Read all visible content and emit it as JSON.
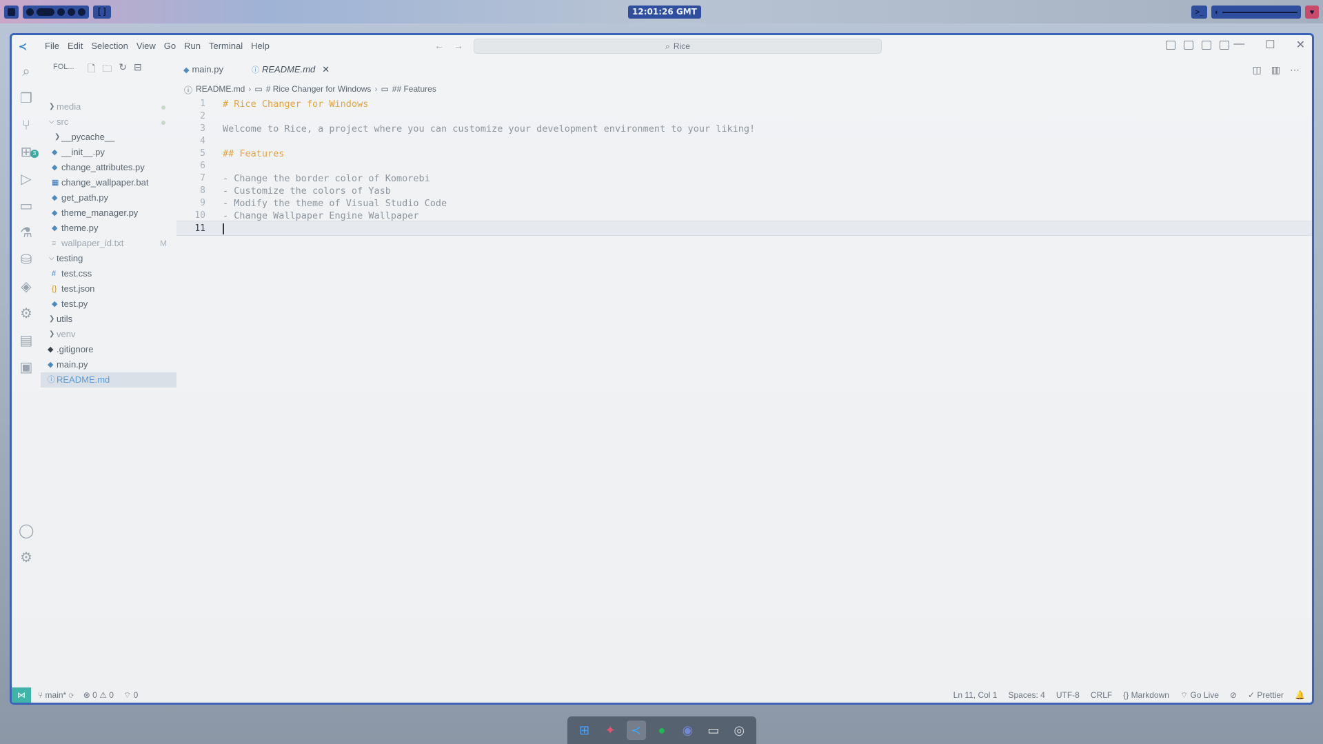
{
  "topbar": {
    "clock": "12:01:26 GMT",
    "terminal_icon": ">_"
  },
  "window": {
    "menu": [
      "File",
      "Edit",
      "Selection",
      "View",
      "Go",
      "Run",
      "Terminal",
      "Help"
    ],
    "search_label": "Rice"
  },
  "activity_bar": {
    "source_control_badge": "3"
  },
  "explorer": {
    "header": "FOL...",
    "items": [
      {
        "label": "media",
        "type": "folder",
        "collapsed": true,
        "dim": true
      },
      {
        "label": "src",
        "type": "folder",
        "collapsed": false,
        "dim": true
      },
      {
        "label": "__pycache__",
        "type": "folder",
        "collapsed": true
      },
      {
        "label": "__init__.py",
        "type": "py"
      },
      {
        "label": "change_attributes.py",
        "type": "py"
      },
      {
        "label": "change_wallpaper.bat",
        "type": "bat"
      },
      {
        "label": "get_path.py",
        "type": "py"
      },
      {
        "label": "theme_manager.py",
        "type": "py"
      },
      {
        "label": "theme.py",
        "type": "py"
      },
      {
        "label": "wallpaper_id.txt",
        "type": "txt",
        "dim": true,
        "badge": "M"
      },
      {
        "label": "testing",
        "type": "folder",
        "collapsed": false
      },
      {
        "label": "test.css",
        "type": "css"
      },
      {
        "label": "test.json",
        "type": "json"
      },
      {
        "label": "test.py",
        "type": "py"
      },
      {
        "label": "utils",
        "type": "folder",
        "collapsed": true
      },
      {
        "label": "venv",
        "type": "folder",
        "collapsed": true,
        "dim": true
      },
      {
        "label": ".gitignore",
        "type": "git"
      },
      {
        "label": "main.py",
        "type": "py"
      },
      {
        "label": "README.md",
        "type": "md",
        "selected": true
      }
    ]
  },
  "tabs": [
    {
      "label": "main.py",
      "active": false
    },
    {
      "label": "README.md",
      "active": true
    }
  ],
  "breadcrumb": [
    "README.md",
    "# Rice Changer for Windows",
    "## Features"
  ],
  "editor": {
    "lines": [
      {
        "n": "1",
        "text": "# Rice Changer for Windows",
        "heading": true
      },
      {
        "n": "2",
        "text": ""
      },
      {
        "n": "3",
        "text": "Welcome to Rice, a project where you can customize your development environment to your liking!"
      },
      {
        "n": "4",
        "text": ""
      },
      {
        "n": "5",
        "text": "## Features",
        "heading": true
      },
      {
        "n": "6",
        "text": ""
      },
      {
        "n": "7",
        "text": "- Change the border color of Komorebi"
      },
      {
        "n": "8",
        "text": "- Customize the colors of Yasb"
      },
      {
        "n": "9",
        "text": "- Modify the theme of Visual Studio Code"
      },
      {
        "n": "10",
        "text": "- Change Wallpaper Engine Wallpaper"
      },
      {
        "n": "11",
        "text": "",
        "current": true
      }
    ]
  },
  "statusbar": {
    "branch": "main*",
    "errors": "0",
    "warnings": "0",
    "ports": "0",
    "position": "Ln 11, Col 1",
    "spaces": "Spaces: 4",
    "encoding": "UTF-8",
    "eol": "CRLF",
    "language": "Markdown",
    "golive": "Go Live",
    "prettier": "Prettier"
  }
}
